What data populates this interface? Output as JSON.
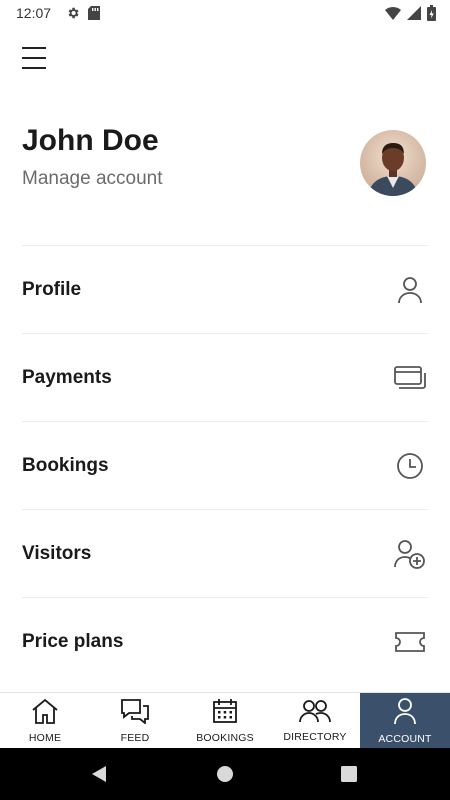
{
  "status_bar": {
    "time": "12:07",
    "left_icons": [
      "gear-icon",
      "sd-card-icon"
    ],
    "right_icons": [
      "wifi-icon",
      "signal-icon",
      "battery-icon"
    ]
  },
  "header": {
    "menu_icon": "hamburger-menu-icon"
  },
  "profile": {
    "name": "John Doe",
    "subtitle": "Manage account",
    "avatar_icon": "avatar"
  },
  "menu": {
    "items": [
      {
        "label": "Profile",
        "icon": "person-icon"
      },
      {
        "label": "Payments",
        "icon": "cards-icon"
      },
      {
        "label": "Bookings",
        "icon": "clock-icon"
      },
      {
        "label": "Visitors",
        "icon": "person-add-icon"
      },
      {
        "label": "Price plans",
        "icon": "ticket-icon"
      }
    ]
  },
  "bottom_nav": {
    "tabs": [
      {
        "label": "HOME",
        "icon": "home-icon"
      },
      {
        "label": "FEED",
        "icon": "chat-icon"
      },
      {
        "label": "BOOKINGS",
        "icon": "calendar-icon"
      },
      {
        "label": "DIRECTORY",
        "icon": "people-icon"
      },
      {
        "label": "ACCOUNT",
        "icon": "person-icon"
      }
    ],
    "active_index": 4,
    "active_color": "#3a506b"
  },
  "system_nav": {
    "buttons": [
      "back-icon",
      "home-circle-icon",
      "recents-icon"
    ]
  }
}
